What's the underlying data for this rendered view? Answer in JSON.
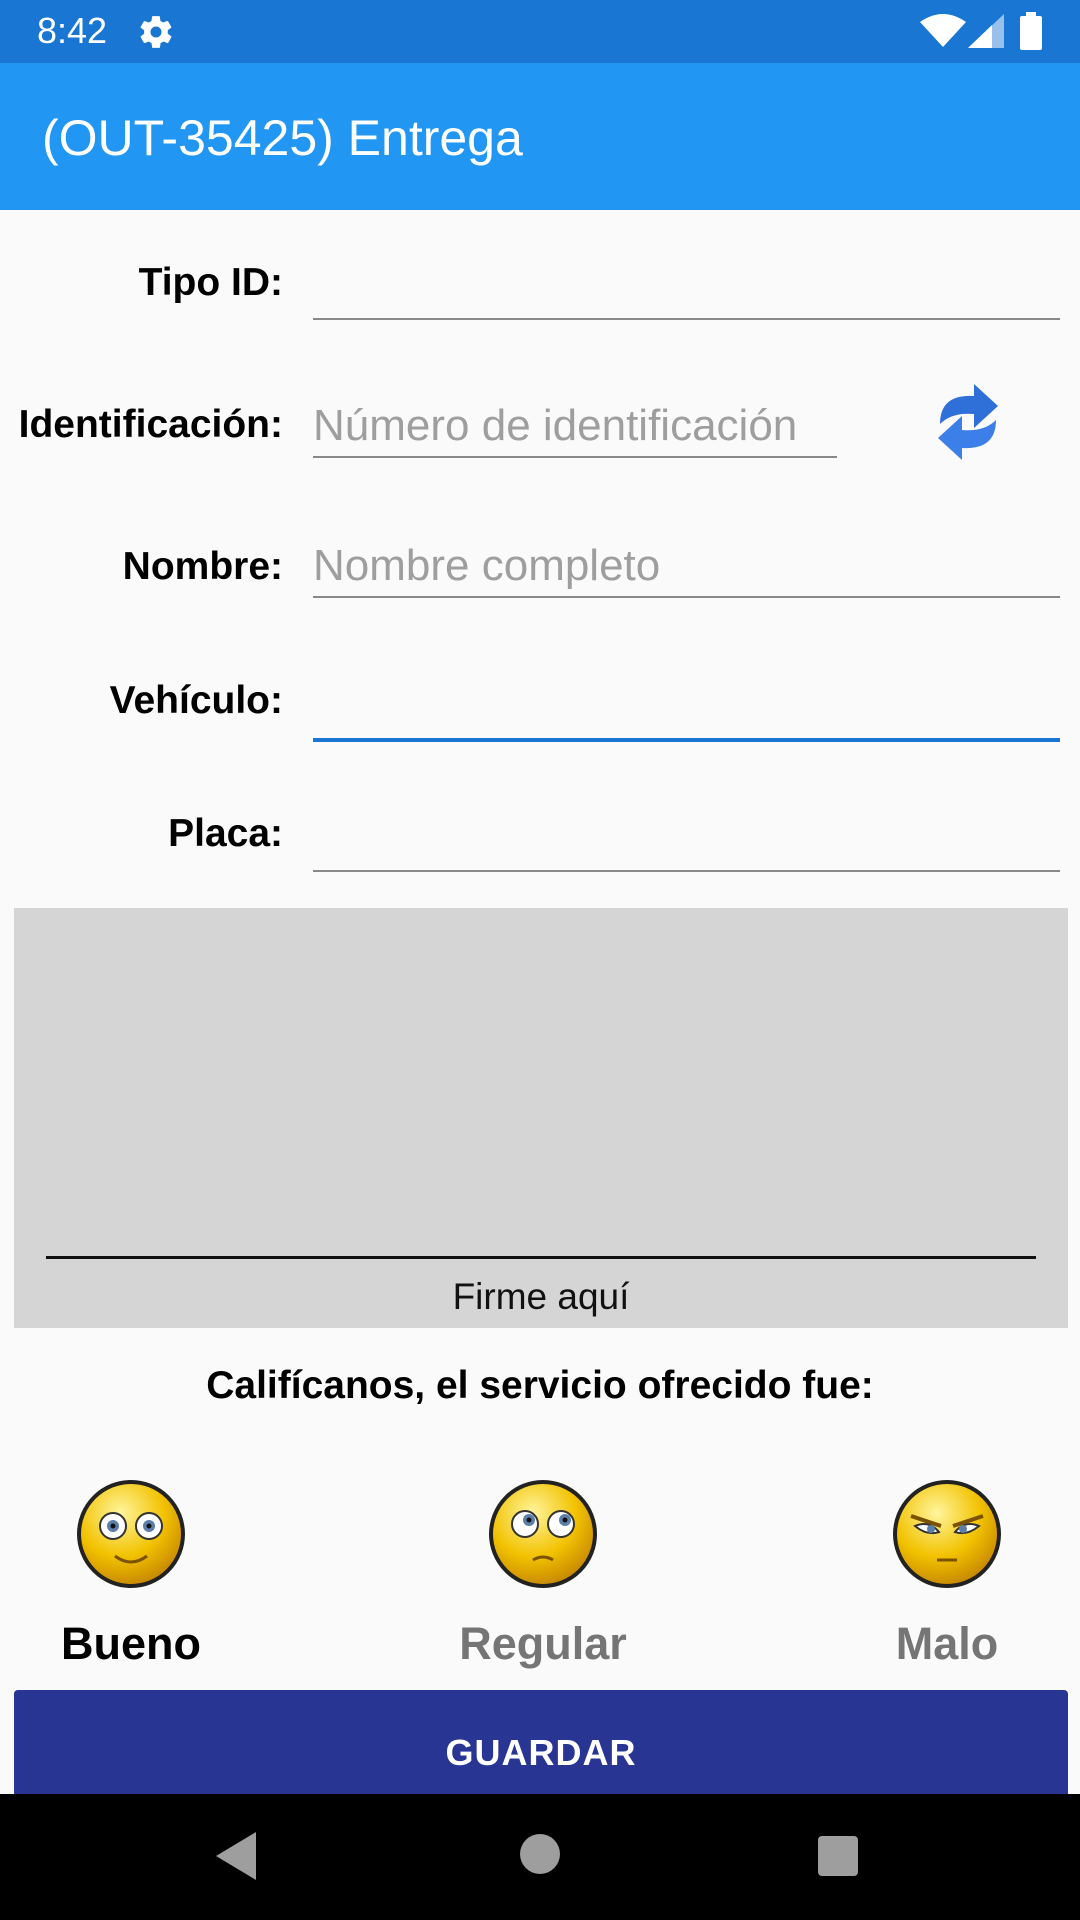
{
  "status_bar": {
    "time": "8:42"
  },
  "app_bar": {
    "title": "(OUT-35425) Entrega"
  },
  "form": {
    "tipo_id": {
      "label": "Tipo ID:",
      "value": ""
    },
    "identificacion": {
      "label": "Identificación:",
      "placeholder": "Número de identificación",
      "value": ""
    },
    "nombre": {
      "label": "Nombre:",
      "placeholder": "Nombre completo",
      "value": ""
    },
    "vehiculo": {
      "label": "Vehículo:",
      "value": ""
    },
    "placa": {
      "label": "Placa:",
      "value": ""
    }
  },
  "signature": {
    "hint": "Firme aquí"
  },
  "rating": {
    "question": "Califícanos, el servicio ofrecido fue:",
    "options": [
      {
        "label": "Bueno",
        "selected": true
      },
      {
        "label": "Regular",
        "selected": false
      },
      {
        "label": "Malo",
        "selected": false
      }
    ]
  },
  "actions": {
    "save_label": "GUARDAR"
  },
  "colors": {
    "status_bar": "#1976d2",
    "app_bar": "#2196f3",
    "accent": "#1976d2",
    "button": "#283593",
    "selected_text": "#000000",
    "unselected_text": "#757575"
  }
}
